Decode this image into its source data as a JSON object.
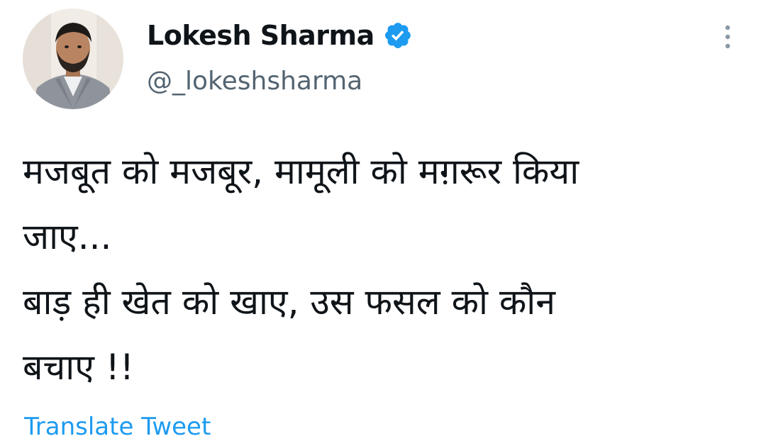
{
  "author": {
    "display_name": "Lokesh Sharma",
    "handle": "@_lokeshsharma",
    "verified": true
  },
  "tweet": {
    "lines": [
      "मजबूत को मजबूर, मामूली को मग़रूर किया",
      "जाए...",
      "बाड़ ही खेत को खाए, उस फसल को कौन",
      "बचाए !!"
    ]
  },
  "translate_label": "Translate Tweet",
  "icons": {
    "verified": "verified-badge-icon",
    "more": "more-vertical-icon"
  },
  "colors": {
    "accent": "#1d9bf0",
    "secondary_text": "#536471",
    "primary_text": "#0f1419"
  }
}
